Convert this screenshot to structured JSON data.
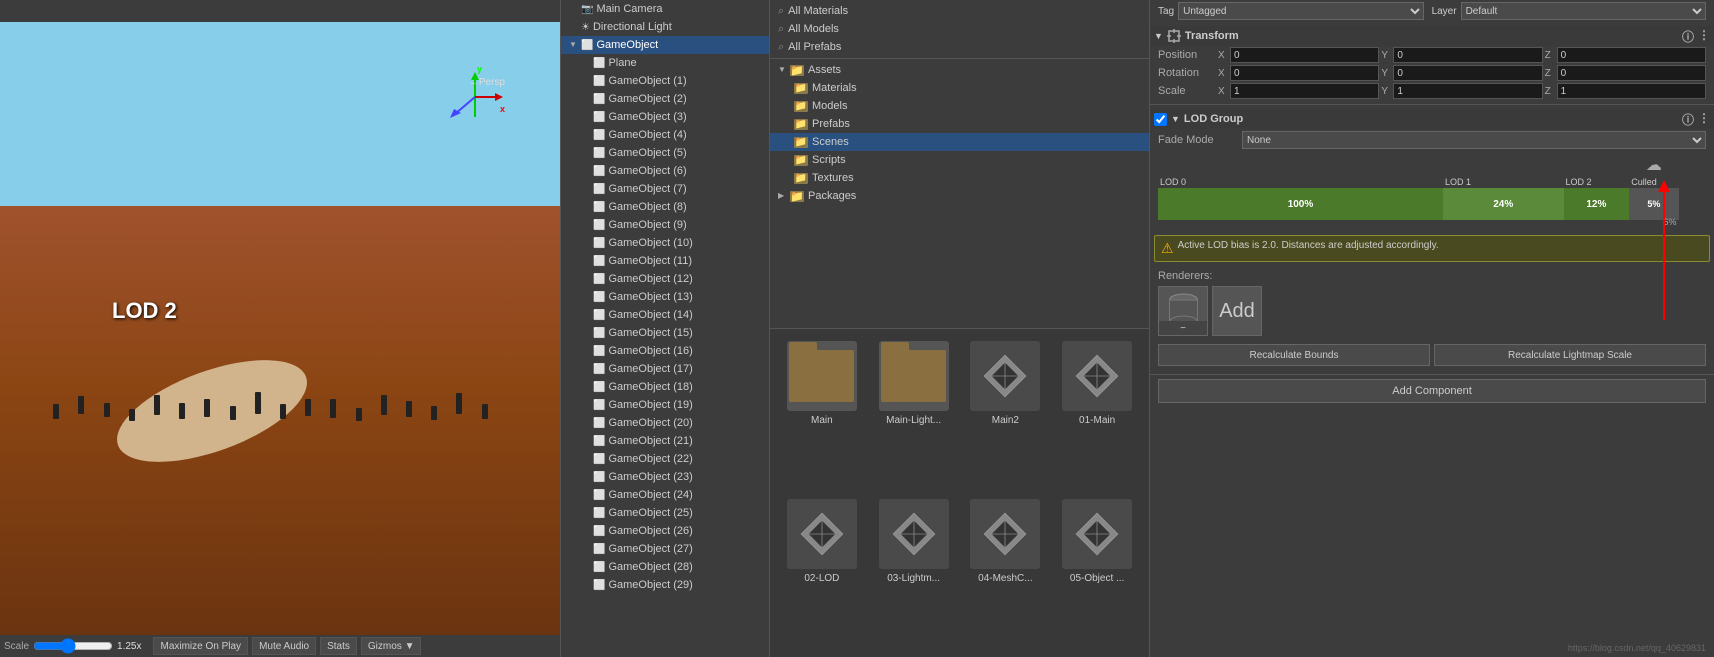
{
  "scene": {
    "lod_label": "LOD 2",
    "persp_label": "←Persp",
    "scale_label": "Scale",
    "scale_value": "1.25x",
    "bottom_buttons": [
      "Maximize On Play",
      "Mute Audio",
      "Stats",
      "Gizmos ▼"
    ]
  },
  "hierarchy": {
    "items": [
      {
        "label": "Main Camera",
        "indent": 0,
        "icon": "camera"
      },
      {
        "label": "Directional Light",
        "indent": 0,
        "icon": "light"
      },
      {
        "label": "GameObject",
        "indent": 0,
        "selected": true,
        "icon": "cube"
      },
      {
        "label": "Plane",
        "indent": 1,
        "icon": "cube"
      },
      {
        "label": "GameObject (1)",
        "indent": 1,
        "icon": "cube"
      },
      {
        "label": "GameObject (2)",
        "indent": 1,
        "icon": "cube"
      },
      {
        "label": "GameObject (3)",
        "indent": 1,
        "icon": "cube"
      },
      {
        "label": "GameObject (4)",
        "indent": 1,
        "icon": "cube"
      },
      {
        "label": "GameObject (5)",
        "indent": 1,
        "icon": "cube"
      },
      {
        "label": "GameObject (6)",
        "indent": 1,
        "icon": "cube"
      },
      {
        "label": "GameObject (7)",
        "indent": 1,
        "icon": "cube"
      },
      {
        "label": "GameObject (8)",
        "indent": 1,
        "icon": "cube"
      },
      {
        "label": "GameObject (9)",
        "indent": 1,
        "icon": "cube"
      },
      {
        "label": "GameObject (10)",
        "indent": 1,
        "icon": "cube"
      },
      {
        "label": "GameObject (11)",
        "indent": 1,
        "icon": "cube"
      },
      {
        "label": "GameObject (12)",
        "indent": 1,
        "icon": "cube"
      },
      {
        "label": "GameObject (13)",
        "indent": 1,
        "icon": "cube"
      },
      {
        "label": "GameObject (14)",
        "indent": 1,
        "icon": "cube"
      },
      {
        "label": "GameObject (15)",
        "indent": 1,
        "icon": "cube"
      },
      {
        "label": "GameObject (16)",
        "indent": 1,
        "icon": "cube"
      },
      {
        "label": "GameObject (17)",
        "indent": 1,
        "icon": "cube"
      },
      {
        "label": "GameObject (18)",
        "indent": 1,
        "icon": "cube"
      },
      {
        "label": "GameObject (19)",
        "indent": 1,
        "icon": "cube"
      },
      {
        "label": "GameObject (20)",
        "indent": 1,
        "icon": "cube"
      },
      {
        "label": "GameObject (21)",
        "indent": 1,
        "icon": "cube"
      },
      {
        "label": "GameObject (22)",
        "indent": 1,
        "icon": "cube"
      },
      {
        "label": "GameObject (23)",
        "indent": 1,
        "icon": "cube"
      },
      {
        "label": "GameObject (24)",
        "indent": 1,
        "icon": "cube"
      },
      {
        "label": "GameObject (25)",
        "indent": 1,
        "icon": "cube"
      },
      {
        "label": "GameObject (26)",
        "indent": 1,
        "icon": "cube"
      },
      {
        "label": "GameObject (27)",
        "indent": 1,
        "icon": "cube"
      },
      {
        "label": "GameObject (28)",
        "indent": 1,
        "icon": "cube"
      },
      {
        "label": "GameObject (29)",
        "indent": 1,
        "icon": "cube"
      }
    ]
  },
  "project": {
    "search_items": [
      {
        "label": "All Materials",
        "icon": "search"
      },
      {
        "label": "All Models",
        "icon": "search"
      },
      {
        "label": "All Prefabs",
        "icon": "search"
      }
    ],
    "folders": [
      {
        "label": "Assets",
        "expanded": true
      },
      {
        "label": "Materials",
        "indent": 1
      },
      {
        "label": "Models",
        "indent": 1
      },
      {
        "label": "Prefabs",
        "indent": 1
      },
      {
        "label": "Scenes",
        "indent": 1,
        "selected": true
      },
      {
        "label": "Scripts",
        "indent": 1
      },
      {
        "label": "Textures",
        "indent": 1
      },
      {
        "label": "Packages",
        "expanded": false
      }
    ],
    "assets": [
      {
        "label": "Main",
        "type": "folder"
      },
      {
        "label": "Main-Light...",
        "type": "folder"
      },
      {
        "label": "Main2",
        "type": "unity"
      },
      {
        "label": "01-Main",
        "type": "unity"
      },
      {
        "label": "02-LOD",
        "type": "unity"
      },
      {
        "label": "03-Lightm...",
        "type": "unity"
      },
      {
        "label": "04-MeshC...",
        "type": "unity"
      },
      {
        "label": "05-Object ...",
        "type": "unity"
      }
    ]
  },
  "inspector": {
    "tag_label": "Tag",
    "tag_value": "Untagged",
    "layer_label": "Layer",
    "layer_value": "Default",
    "transform": {
      "title": "Transform",
      "position_label": "Position",
      "rotation_label": "Rotation",
      "scale_label": "Scale",
      "position": {
        "x": "0",
        "y": "0",
        "z": "0"
      },
      "rotation": {
        "x": "0",
        "y": "0",
        "z": "0"
      },
      "scale": {
        "x": "1",
        "y": "1",
        "z": "1"
      }
    },
    "lod_group": {
      "title": "LOD Group",
      "fade_mode_label": "Fade Mode",
      "fade_mode_value": "None",
      "bars": [
        {
          "label": "LOD 0",
          "pct": "100%",
          "color": "#4a7a2a",
          "width": "52%"
        },
        {
          "label": "LOD 1",
          "pct": "24%",
          "color": "#5a8a3a",
          "width": "22%"
        },
        {
          "label": "LOD 2",
          "pct": "12%",
          "color": "#4a7a2a",
          "width": "12%"
        },
        {
          "label": "Culled",
          "pct": "5%",
          "color": "#555555",
          "width": "9%"
        }
      ],
      "extra_pct": "6%",
      "warning_text": "Active LOD bias is 2.0. Distances are adjusted accordingly.",
      "renderers_label": "Renderers:",
      "add_label": "Add",
      "minus_label": "-",
      "recalculate_bounds": "Recalculate Bounds",
      "recalculate_lightmap": "Recalculate Lightmap Scale"
    },
    "add_component_label": "Add Component"
  },
  "status_bar": {
    "url": "https://blog.csdn.net/qq_40629831"
  }
}
